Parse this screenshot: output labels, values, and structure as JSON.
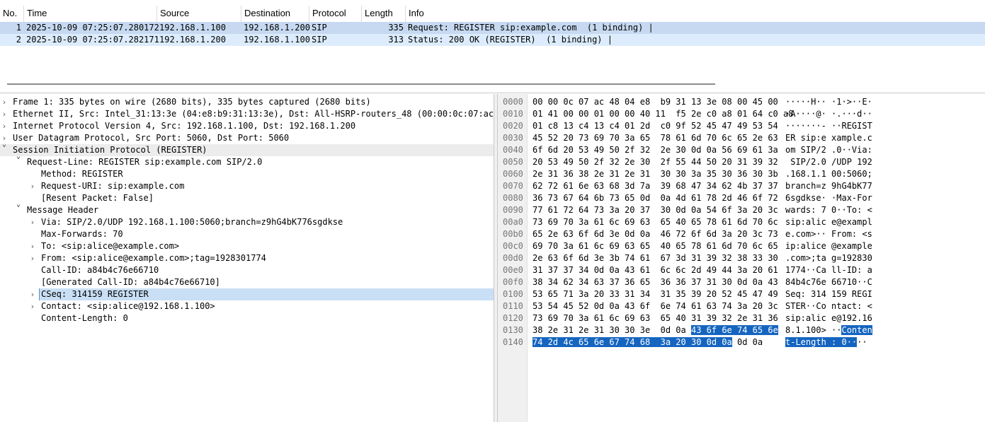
{
  "packet_list": {
    "columns": [
      "No.",
      "Time",
      "Source",
      "Destination",
      "Protocol",
      "Length",
      "Info"
    ],
    "rows": [
      {
        "no": "1",
        "time": "2025-10-09 07:25:07.280172",
        "source": "192.168.1.100",
        "destination": "192.168.1.200",
        "protocol": "SIP",
        "length": "335",
        "info": "Request: REGISTER sip:example.com  (1 binding) |"
      },
      {
        "no": "2",
        "time": "2025-10-09 07:25:07.282171",
        "source": "192.168.1.200",
        "destination": "192.168.1.100",
        "protocol": "SIP",
        "length": "313",
        "info": "Status: 200 OK (REGISTER)  (1 binding) |"
      }
    ]
  },
  "details": [
    {
      "text": "Frame 1: 335 bytes on wire (2680 bits), 335 bytes captured (2680 bits)",
      "arrow": ">"
    },
    {
      "text": "Ethernet II, Src: Intel_31:13:3e (04:e8:b9:31:13:3e), Dst: All-HSRP-routers_48 (00:00:0c:07:ac:48)",
      "arrow": ">"
    },
    {
      "text": "Internet Protocol Version 4, Src: 192.168.1.100, Dst: 192.168.1.200",
      "arrow": ">"
    },
    {
      "text": "User Datagram Protocol, Src Port: 5060, Dst Port: 5060",
      "arrow": ">"
    },
    {
      "text": "Session Initiation Protocol (REGISTER)",
      "arrow": "v"
    },
    {
      "text": "Request-Line: REGISTER sip:example.com SIP/2.0",
      "arrow": "v"
    },
    {
      "text": "Method: REGISTER",
      "arrow": ""
    },
    {
      "text": "Request-URI: sip:example.com",
      "arrow": ">"
    },
    {
      "text": "[Resent Packet: False]",
      "arrow": ""
    },
    {
      "text": "Message Header",
      "arrow": "v"
    },
    {
      "text": "Via: SIP/2.0/UDP 192.168.1.100:5060;branch=z9hG4bK776sgdkse",
      "arrow": ">"
    },
    {
      "text": "Max-Forwards: 70",
      "arrow": ""
    },
    {
      "text": "To: <sip:alice@example.com>",
      "arrow": ">"
    },
    {
      "text": "From: <sip:alice@example.com>;tag=1928301774",
      "arrow": ">"
    },
    {
      "text": "Call-ID: a84b4c76e66710",
      "arrow": ""
    },
    {
      "text": "[Generated Call-ID: a84b4c76e66710]",
      "arrow": ""
    },
    {
      "text": "CSeq: 314159 REGISTER",
      "arrow": ">"
    },
    {
      "text": "Contact: <sip:alice@192.168.1.100>",
      "arrow": ">"
    },
    {
      "text": "Content-Length: 0",
      "arrow": ""
    }
  ],
  "hex": [
    {
      "offset": "0000",
      "hex_a": "00 00 0c 07 ac 48 04 e8  b9 31 13 3e 08 00 45 00",
      "hex_b": "",
      "ascii_a": "·····H·· ·1·>··E·",
      "ascii_b": ""
    },
    {
      "offset": "0010",
      "hex_a": "01 41 00 00 01 00 00 40 11  f5 2e c0 a8 01 64 c0 a8",
      "hex_b": "",
      "ascii_a": "·A····@· ·.···d··",
      "ascii_b": ""
    },
    {
      "offset": "0020",
      "hex_a": "01 c8 13 c4 13 c4 01 2d  c0 9f 52 45 47 49 53 54",
      "hex_b": "",
      "ascii_a": "·······- ··REGIST",
      "ascii_b": ""
    },
    {
      "offset": "0030",
      "hex_a": "45 52 20 73 69 70 3a 65  78 61 6d 70 6c 65 2e 63",
      "hex_b": "",
      "ascii_a": "ER sip:e xample.c",
      "ascii_b": ""
    },
    {
      "offset": "0040",
      "hex_a": "6f 6d 20 53 49 50 2f 32  2e 30 0d 0a 56 69 61 3a",
      "hex_b": "",
      "ascii_a": "om SIP/2 .0··Via:",
      "ascii_b": ""
    },
    {
      "offset": "0050",
      "hex_a": "20 53 49 50 2f 32 2e 30  2f 55 44 50 20 31 39 32",
      "hex_b": "",
      "ascii_a": " SIP/2.0 /UDP 192",
      "ascii_b": ""
    },
    {
      "offset": "0060",
      "hex_a": "2e 31 36 38 2e 31 2e 31  30 30 3a 35 30 36 30 3b",
      "hex_b": "",
      "ascii_a": ".168.1.1 00:5060;",
      "ascii_b": ""
    },
    {
      "offset": "0070",
      "hex_a": "62 72 61 6e 63 68 3d 7a  39 68 47 34 62 4b 37 37",
      "hex_b": "",
      "ascii_a": "branch=z 9hG4bK77",
      "ascii_b": ""
    },
    {
      "offset": "0080",
      "hex_a": "36 73 67 64 6b 73 65 0d  0a 4d 61 78 2d 46 6f 72",
      "hex_b": "",
      "ascii_a": "6sgdkse· ·Max-For",
      "ascii_b": ""
    },
    {
      "offset": "0090",
      "hex_a": "77 61 72 64 73 3a 20 37  30 0d 0a 54 6f 3a 20 3c",
      "hex_b": "",
      "ascii_a": "wards: 7 0··To: <",
      "ascii_b": ""
    },
    {
      "offset": "00a0",
      "hex_a": "73 69 70 3a 61 6c 69 63  65 40 65 78 61 6d 70 6c",
      "hex_b": "",
      "ascii_a": "sip:alic e@exampl",
      "ascii_b": ""
    },
    {
      "offset": "00b0",
      "hex_a": "65 2e 63 6f 6d 3e 0d 0a  46 72 6f 6d 3a 20 3c 73",
      "hex_b": "",
      "ascii_a": "e.com>·· From: <s",
      "ascii_b": ""
    },
    {
      "offset": "00c0",
      "hex_a": "69 70 3a 61 6c 69 63 65  40 65 78 61 6d 70 6c 65",
      "hex_b": "",
      "ascii_a": "ip:alice @example",
      "ascii_b": ""
    },
    {
      "offset": "00d0",
      "hex_a": "2e 63 6f 6d 3e 3b 74 61  67 3d 31 39 32 38 33 30",
      "hex_b": "",
      "ascii_a": ".com>;ta g=192830",
      "ascii_b": ""
    },
    {
      "offset": "00e0",
      "hex_a": "31 37 37 34 0d 0a 43 61  6c 6c 2d 49 44 3a 20 61",
      "hex_b": "",
      "ascii_a": "1774··Ca ll-ID: a",
      "ascii_b": ""
    },
    {
      "offset": "00f0",
      "hex_a": "38 34 62 34 63 37 36 65  36 36 37 31 30 0d 0a 43",
      "hex_b": "",
      "ascii_a": "84b4c76e 66710··C",
      "ascii_b": ""
    },
    {
      "offset": "0100",
      "hex_a": "53 65 71 3a 20 33 31 34  31 35 39 20 52 45 47 49",
      "hex_b": "",
      "ascii_a": "Seq: 314 159 REGI",
      "ascii_b": ""
    },
    {
      "offset": "0110",
      "hex_a": "53 54 45 52 0d 0a 43 6f  6e 74 61 63 74 3a 20 3c",
      "hex_b": "",
      "ascii_a": "STER··Co ntact: <",
      "ascii_b": ""
    },
    {
      "offset": "0120",
      "hex_a": "73 69 70 3a 61 6c 69 63  65 40 31 39 32 2e 31 36",
      "hex_b": "",
      "ascii_a": "sip:alic e@192.16",
      "ascii_b": ""
    },
    {
      "offset": "0130",
      "hex_a": "38 2e 31 2e 31 30 30 3e  0d 0a ",
      "hex_b": "43 6f 6e 74 65 6e",
      "ascii_a": "8.1.100> ··",
      "ascii_b": "Conten"
    },
    {
      "offset": "0140",
      "hex_a": "",
      "hex_b": "74 2d 4c 65 6e 67 74 68  3a 20 30 0d 0a",
      "ascii_a": "",
      "ascii_b": "t-Length : 0··",
      "hex_c": " 0d 0a",
      "ascii_c": "··"
    }
  ]
}
